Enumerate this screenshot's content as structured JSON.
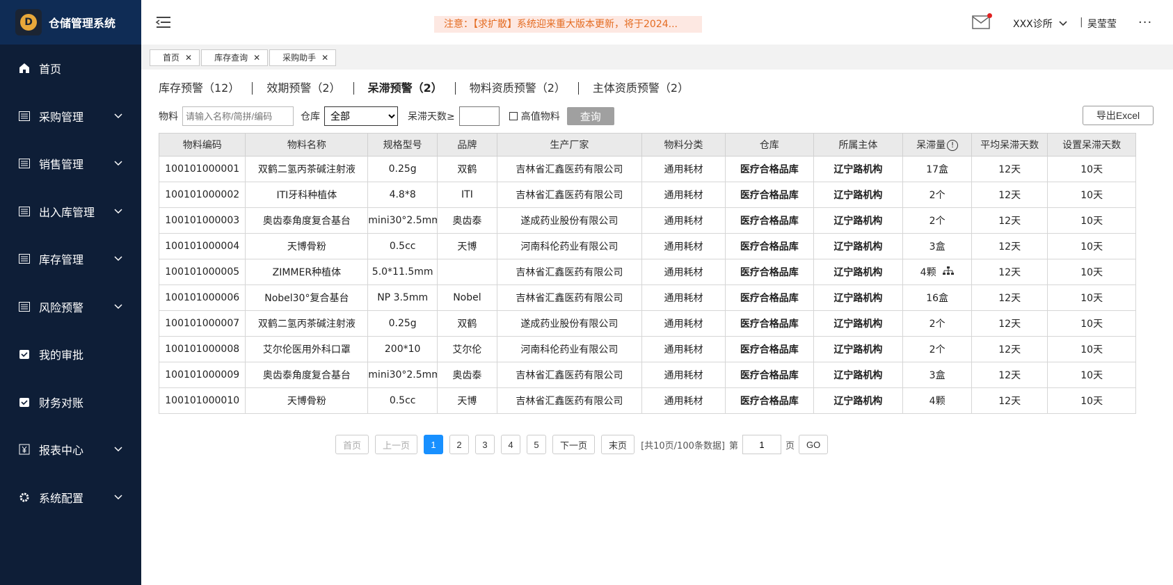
{
  "app": {
    "title": "仓储管理系统",
    "logo_letter": "D"
  },
  "sidebar": {
    "items": [
      {
        "label": "首页",
        "icon": "home-icon",
        "expandable": false
      },
      {
        "label": "采购管理",
        "icon": "list-icon",
        "expandable": true
      },
      {
        "label": "销售管理",
        "icon": "list-icon",
        "expandable": true
      },
      {
        "label": "出入库管理",
        "icon": "list-icon",
        "expandable": true
      },
      {
        "label": "库存管理",
        "icon": "list-icon",
        "expandable": true
      },
      {
        "label": "风险预警",
        "icon": "list-icon",
        "expandable": true
      },
      {
        "label": "我的审批",
        "icon": "approval-icon",
        "expandable": false
      },
      {
        "label": "财务对账",
        "icon": "approval-icon",
        "expandable": false
      },
      {
        "label": "报表中心",
        "icon": "yen-icon",
        "expandable": true
      },
      {
        "label": "系统配置",
        "icon": "gear-icon",
        "expandable": true
      }
    ]
  },
  "header": {
    "notice": "注意：【求扩散】系统迎来重大版本更新，将于2024...",
    "clinic": "XXX诊所",
    "separator": "|",
    "user": "吴莹莹",
    "more": "···"
  },
  "tabs": [
    {
      "label": "首页"
    },
    {
      "label": "库存查询"
    },
    {
      "label": "采购助手"
    }
  ],
  "subtabs": [
    {
      "label": "库存预警（12）",
      "active": false
    },
    {
      "label": "效期预警（2）",
      "active": false
    },
    {
      "label": "呆滞预警（2）",
      "active": true
    },
    {
      "label": "物料资质预警（2）",
      "active": false
    },
    {
      "label": "主体资质预警（2）",
      "active": false
    }
  ],
  "filters": {
    "material_label": "物料",
    "material_placeholder": "请输入名称/简拼/编码",
    "warehouse_label": "仓库",
    "warehouse_value": "全部",
    "days_label": "呆滞天数≥",
    "high_value_label": "高值物料",
    "query_label": "查询",
    "export_label": "导出Excel"
  },
  "table": {
    "headers": [
      "物料编码",
      "物料名称",
      "规格型号",
      "品牌",
      "生产厂家",
      "物料分类",
      "仓库",
      "所属主体",
      "呆滞量",
      "平均呆滞天数",
      "设置呆滞天数"
    ],
    "rows": [
      [
        "100101000001",
        "双鹤二氢丙茶碱注射液",
        "0.25g",
        "双鹤",
        "吉林省汇鑫医药有限公司",
        "通用耗材",
        "医疗合格品库",
        "辽宁路机构",
        "17盒",
        "12天",
        "10天"
      ],
      [
        "100101000002",
        "ITI牙科种植体",
        "4.8*8",
        "ITI",
        "吉林省汇鑫医药有限公司",
        "通用耗材",
        "医疗合格品库",
        "辽宁路机构",
        "2个",
        "12天",
        "10天"
      ],
      [
        "100101000003",
        "奥齿泰角度复合基台",
        "mini30°2.5mm",
        "奥齿泰",
        "遂成药业股份有限公司",
        "通用耗材",
        "医疗合格品库",
        "辽宁路机构",
        "2个",
        "12天",
        "10天"
      ],
      [
        "100101000004",
        "天博骨粉",
        "0.5cc",
        "天博",
        "河南科伦药业有限公司",
        "通用耗材",
        "医疗合格品库",
        "辽宁路机构",
        "3盒",
        "12天",
        "10天"
      ],
      [
        "100101000005",
        "ZIMMER种植体",
        "5.0*11.5mm",
        "",
        "吉林省汇鑫医药有限公司",
        "通用耗材",
        "医疗合格品库",
        "辽宁路机构",
        "4颗",
        "12天",
        "10天"
      ],
      [
        "100101000006",
        "Nobel30°复合基台",
        "NP 3.5mm",
        "Nobel",
        "吉林省汇鑫医药有限公司",
        "通用耗材",
        "医疗合格品库",
        "辽宁路机构",
        "16盒",
        "12天",
        "10天"
      ],
      [
        "100101000007",
        "双鹤二氢丙茶碱注射液",
        "0.25g",
        "双鹤",
        "遂成药业股份有限公司",
        "通用耗材",
        "医疗合格品库",
        "辽宁路机构",
        "2个",
        "12天",
        "10天"
      ],
      [
        "100101000008",
        "艾尔伦医用外科口罩",
        "200*10",
        "艾尔伦",
        "河南科伦药业有限公司",
        "通用耗材",
        "医疗合格品库",
        "辽宁路机构",
        "2个",
        "12天",
        "10天"
      ],
      [
        "100101000009",
        "奥齿泰角度复合基台",
        "mini30°2.5mm",
        "奥齿泰",
        "吉林省汇鑫医药有限公司",
        "通用耗材",
        "医疗合格品库",
        "辽宁路机构",
        "3盒",
        "12天",
        "10天"
      ],
      [
        "100101000010",
        "天博骨粉",
        "0.5cc",
        "天博",
        "吉林省汇鑫医药有限公司",
        "通用耗材",
        "医疗合格品库",
        "辽宁路机构",
        "4颗",
        "12天",
        "10天"
      ]
    ]
  },
  "pagination": {
    "first": "首页",
    "prev": "上一页",
    "pages": [
      "1",
      "2",
      "3",
      "4",
      "5"
    ],
    "current": "1",
    "next": "下一页",
    "last": "末页",
    "summary": "[共10页/100条数据]",
    "goto_prefix": "第",
    "goto_value": "1",
    "goto_suffix": "页",
    "go": "GO"
  },
  "colors": {
    "sidebar_bg": "#0e1e37",
    "brand_bg": "#0f2c55",
    "accent": "#1890ff",
    "notice_text": "#e46c22"
  }
}
